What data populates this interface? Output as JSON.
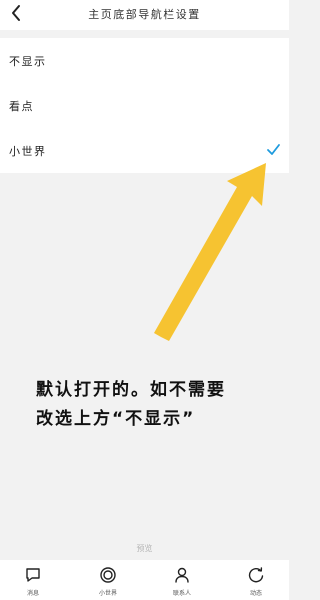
{
  "header": {
    "title": "主页底部导航栏设置"
  },
  "options": [
    {
      "label": "不显示",
      "selected": false
    },
    {
      "label": "看点",
      "selected": false
    },
    {
      "label": "小世界",
      "selected": true
    }
  ],
  "accent_color": "#1e9bde",
  "annotation": {
    "line1": "默认打开的。如不需要",
    "line2": "改选上方“不显示”"
  },
  "arrow_color": "#f6c331",
  "footer_label": "预览",
  "tabbar": {
    "tabs": [
      {
        "label": "消息",
        "icon": "message-icon"
      },
      {
        "label": "小世界",
        "icon": "small-world-icon"
      },
      {
        "label": "联系人",
        "icon": "contacts-icon"
      },
      {
        "label": "动态",
        "icon": "activity-icon"
      }
    ]
  }
}
